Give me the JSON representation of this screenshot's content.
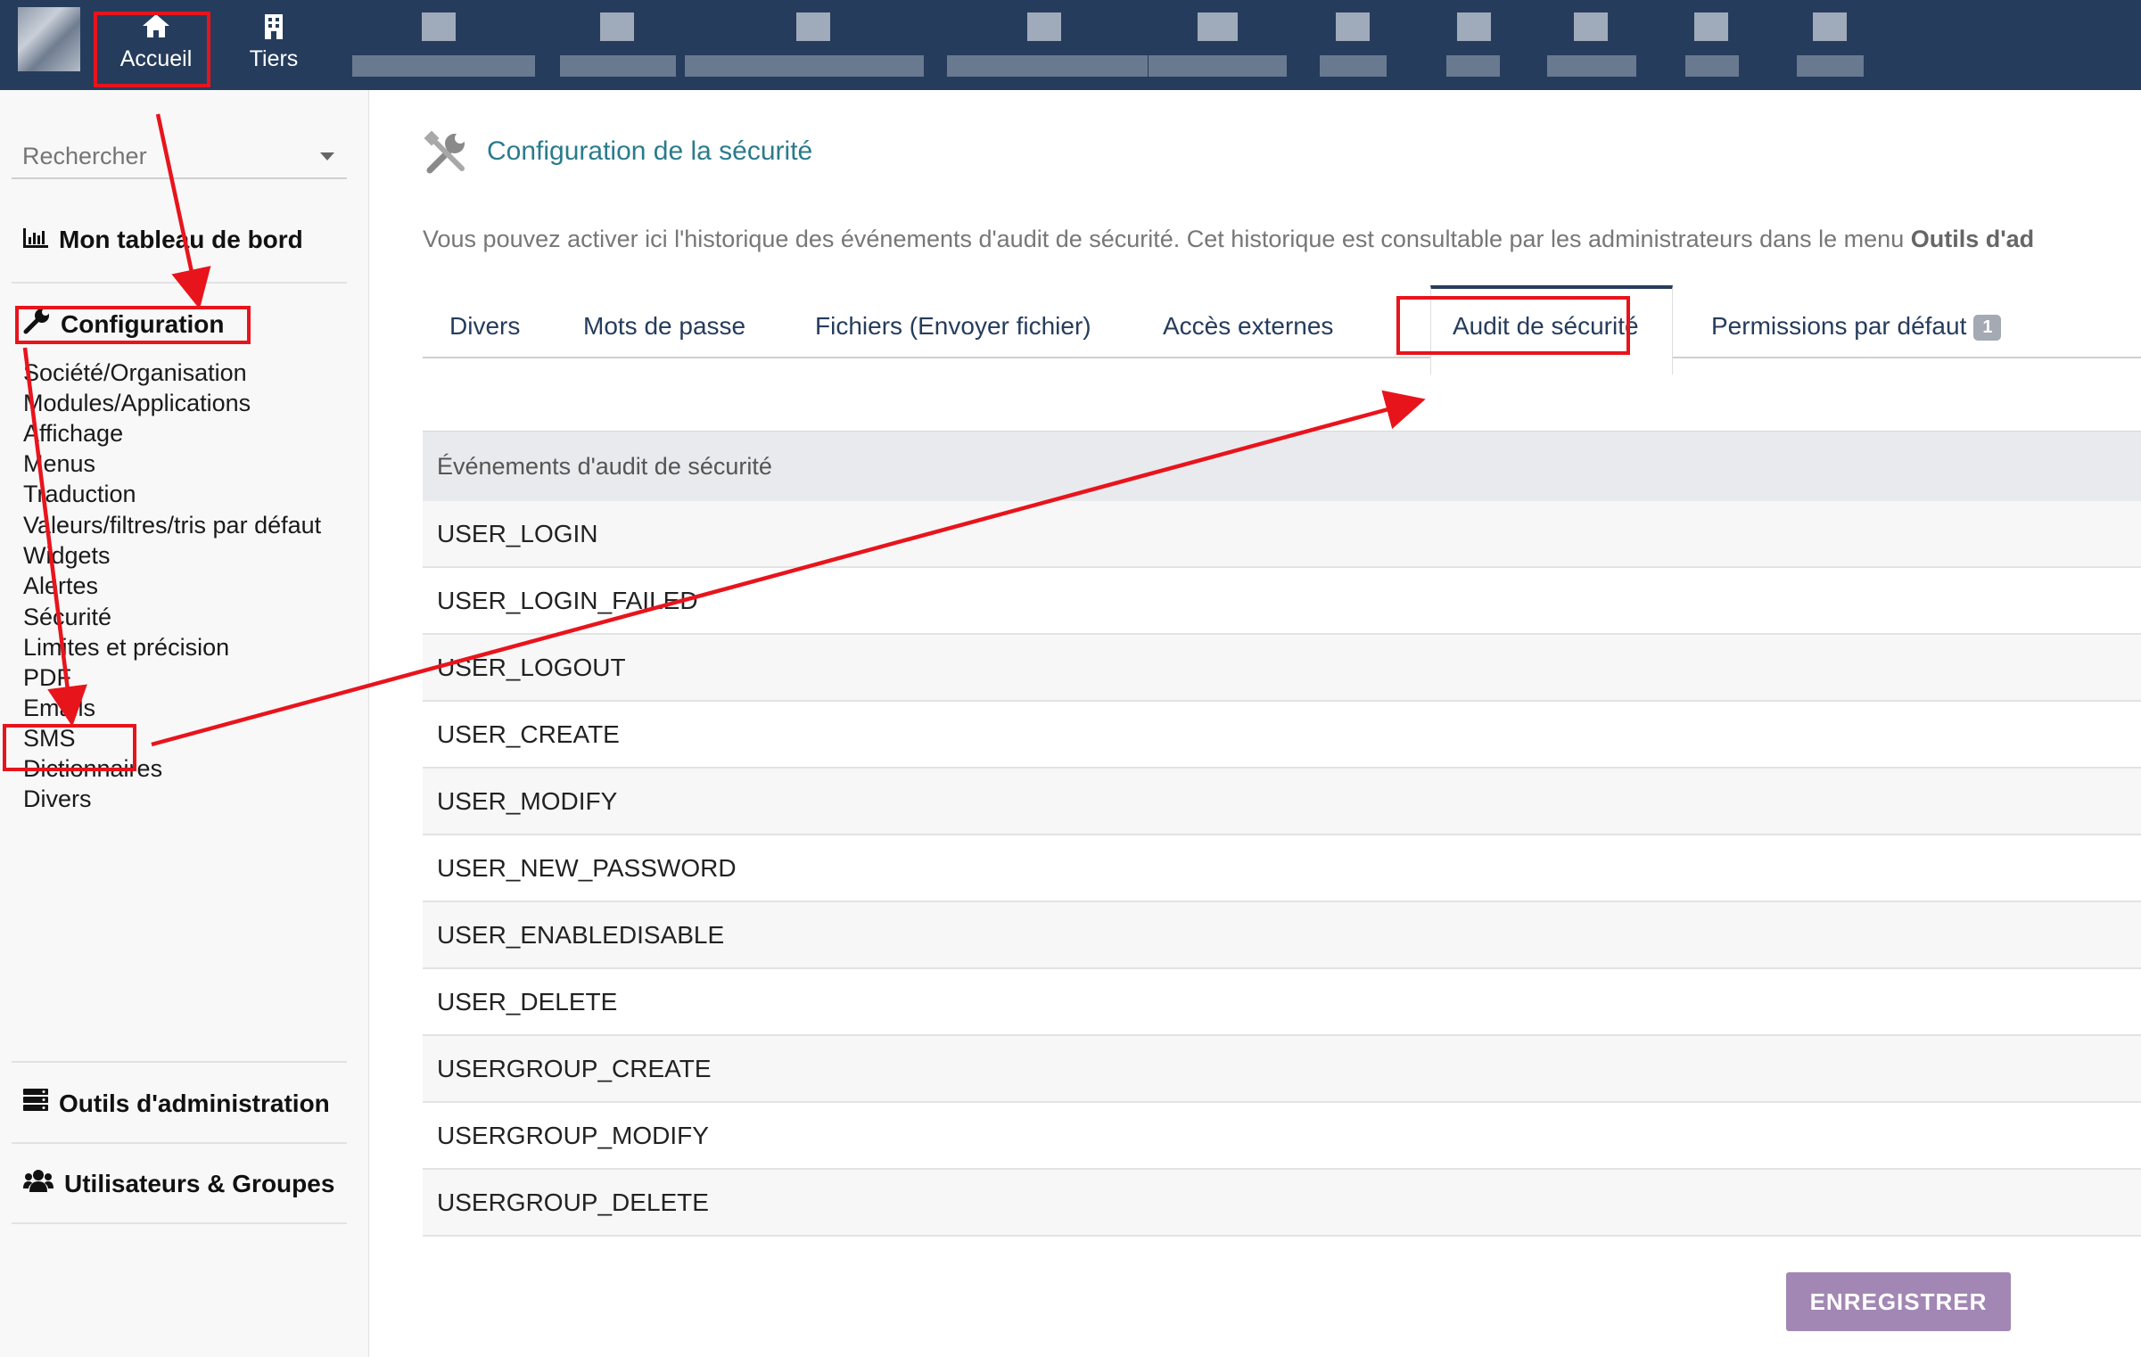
{
  "topbar": {
    "home_label": "Accueil",
    "thirdparty_label": "Tiers"
  },
  "sidebar": {
    "search_placeholder": "Rechercher",
    "dashboard_label": "Mon tableau de bord",
    "config_label": "Configuration",
    "config_items": [
      "Société/Organisation",
      "Modules/Applications",
      "Affichage",
      "Menus",
      "Traduction",
      "Valeurs/filtres/tris par défaut",
      "Widgets",
      "Alertes",
      "Sécurité",
      "Limites et précision",
      "PDF",
      "Emails",
      "SMS",
      "Dictionnaires",
      "Divers"
    ],
    "admin_tools_label": "Outils d'administration",
    "users_groups_label": "Utilisateurs & Groupes"
  },
  "main": {
    "page_title": "Configuration de la sécurité",
    "intro_text": "Vous pouvez activer ici l'historique des événements d'audit de sécurité. Cet historique est consultable par les administrateurs dans le menu ",
    "intro_bold": "Outils d'ad",
    "tabs": [
      {
        "label": "Divers"
      },
      {
        "label": "Mots de passe"
      },
      {
        "label": "Fichiers (Envoyer fichier)"
      },
      {
        "label": "Accès externes"
      },
      {
        "label": "Audit de sécurité",
        "active": true
      },
      {
        "label": "Permissions par défaut",
        "badge": "1"
      }
    ],
    "table_header": "Événements d'audit de sécurité",
    "events": [
      "USER_LOGIN",
      "USER_LOGIN_FAILED",
      "USER_LOGOUT",
      "USER_CREATE",
      "USER_MODIFY",
      "USER_NEW_PASSWORD",
      "USER_ENABLEDISABLE",
      "USER_DELETE",
      "USERGROUP_CREATE",
      "USERGROUP_MODIFY",
      "USERGROUP_DELETE"
    ],
    "save_label": "ENREGISTRER"
  },
  "colors": {
    "topbar": "#263c5c",
    "title_teal": "#2a7b8c",
    "tab_text": "#263c5c",
    "annotation_red": "#e8141c",
    "save_button": "#a287b4"
  }
}
